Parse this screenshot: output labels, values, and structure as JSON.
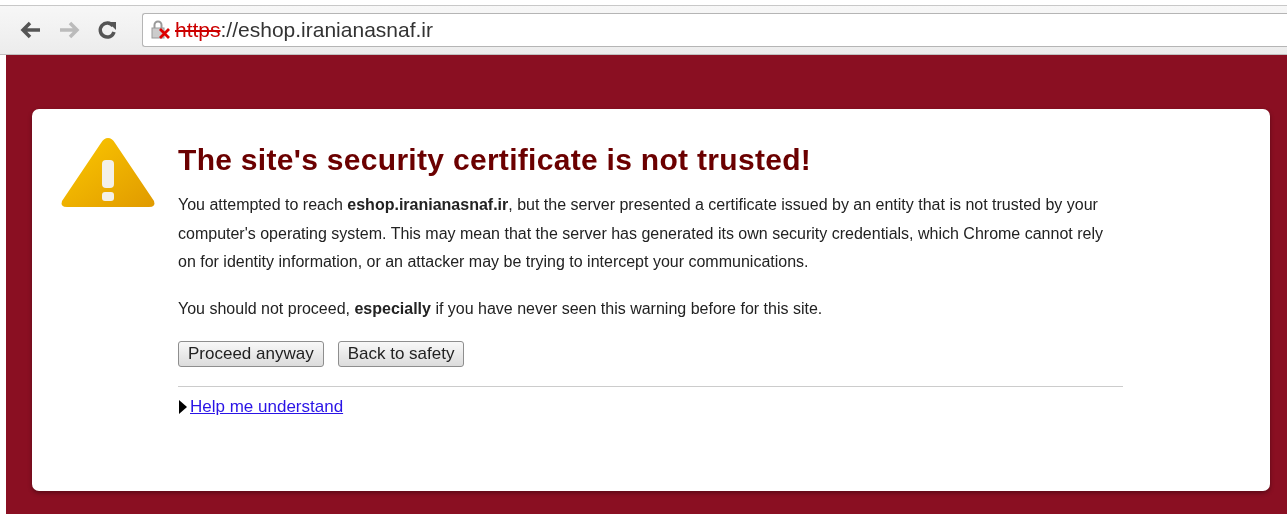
{
  "toolbar": {
    "back_enabled": true,
    "forward_enabled": false
  },
  "address_bar": {
    "scheme": "https",
    "rest": "://eshop.iranianasnaf.ir",
    "certificate_error": true
  },
  "warning": {
    "title": "The site's security certificate is not trusted!",
    "paragraphs": [
      "You attempted to reach **eshop.iranianasnaf.ir**, but the server presented a certificate issued by an entity that is not trusted by your computer's operating system. This may mean that the server has generated its own security credentials, which Chrome cannot rely on for identity information, or an attacker may be trying to intercept your communications.",
      "You should not proceed, **especially** if you have never seen this warning before for this site."
    ],
    "buttons": [
      "Proceed anyway",
      "Back to safety"
    ],
    "help_link": {
      "label": "Help me understand",
      "expanded": false
    }
  }
}
